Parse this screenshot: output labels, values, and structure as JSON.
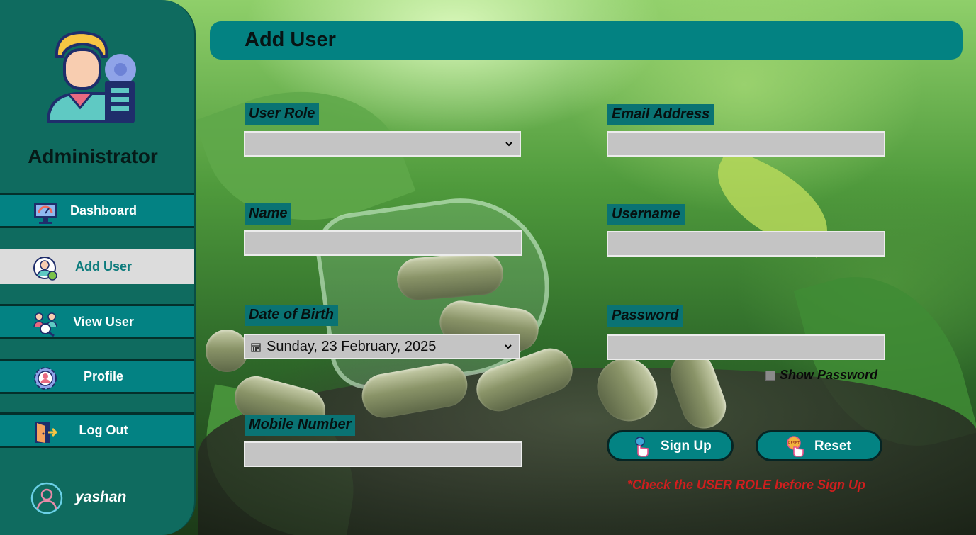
{
  "sidebar": {
    "title": "Administrator",
    "items": [
      {
        "label": "Dashboard",
        "icon": "dashboard-monitor-icon"
      },
      {
        "label": "Add User",
        "icon": "add-user-icon",
        "active": true
      },
      {
        "label": "View User",
        "icon": "view-users-icon"
      },
      {
        "label": "Profile",
        "icon": "profile-gear-icon"
      },
      {
        "label": "Log Out",
        "icon": "logout-door-icon"
      }
    ],
    "username": "yashan"
  },
  "header": {
    "title": "Add User"
  },
  "form": {
    "user_role": {
      "label": "User Role",
      "value": ""
    },
    "name": {
      "label": "Name",
      "value": ""
    },
    "date_of_birth": {
      "label": "Date of Birth",
      "value": "Sunday, 23 February, 2025"
    },
    "mobile_number": {
      "label": "Mobile Number",
      "value": ""
    },
    "email": {
      "label": "Email Address",
      "value": ""
    },
    "username": {
      "label": "Username",
      "value": ""
    },
    "password": {
      "label": "Password",
      "value": ""
    },
    "show_password": {
      "label": "Show Password",
      "checked": false
    }
  },
  "buttons": {
    "signup": "Sign Up",
    "reset": "Reset",
    "reset_icon_text": "RESET"
  },
  "warning": "*Check the USER ROLE before Sign Up",
  "colors": {
    "sidebar": "#0f6b5f",
    "accent": "#038282",
    "active_nav": "#dcdcdc",
    "input": "#c4c4c4",
    "warning": "#d01e1e"
  }
}
